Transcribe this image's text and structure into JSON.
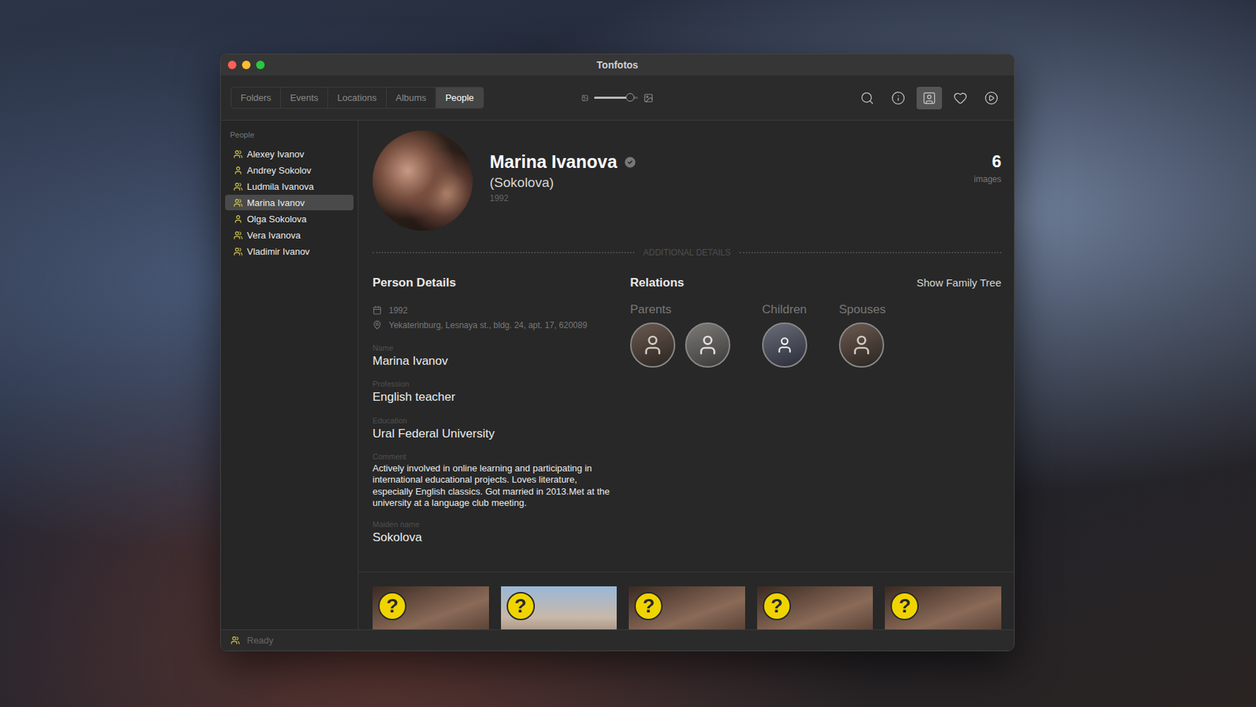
{
  "window": {
    "title": "Tonfotos"
  },
  "tabs": [
    {
      "label": "Folders",
      "selected": false
    },
    {
      "label": "Events",
      "selected": false
    },
    {
      "label": "Locations",
      "selected": false
    },
    {
      "label": "Albums",
      "selected": false
    },
    {
      "label": "People",
      "selected": true
    }
  ],
  "zoom": {
    "level": 0.82
  },
  "toolbar_buttons": [
    {
      "selected": false
    },
    {
      "selected": false
    },
    {
      "selected": true
    },
    {
      "selected": false
    },
    {
      "selected": false
    }
  ],
  "sidebar": {
    "header": "People",
    "items": [
      {
        "label": "Alexey Ivanov",
        "kind": "family",
        "selected": false
      },
      {
        "label": "Andrey Sokolov",
        "kind": "single",
        "selected": false
      },
      {
        "label": "Ludmila Ivanova",
        "kind": "family",
        "selected": false
      },
      {
        "label": "Marina Ivanov",
        "kind": "family",
        "selected": true
      },
      {
        "label": "Olga Sokolova",
        "kind": "single",
        "selected": false
      },
      {
        "label": "Vera Ivanova",
        "kind": "family",
        "selected": false
      },
      {
        "label": "Vladimir Ivanov",
        "kind": "family",
        "selected": false
      }
    ]
  },
  "person": {
    "name": "Marina Ivanova",
    "verified": true,
    "maiden": "(Sokolova)",
    "year": "1992",
    "image_count": "6",
    "image_label": "images"
  },
  "section_label": "ADDITIONAL DETAILS",
  "details": {
    "title": "Person Details",
    "birth": "1992",
    "address": "Yekaterinburg, Lesnaya st., bldg. 24, apt. 17, 620089",
    "fields": [
      {
        "label": "Name",
        "value": "Marina Ivanov",
        "kind": "large"
      },
      {
        "label": "Profession",
        "value": "English teacher",
        "kind": "large"
      },
      {
        "label": "Education",
        "value": "Ural Federal University",
        "kind": "large"
      },
      {
        "label": "Comment",
        "value": "Actively involved in online learning and participating in international educational projects. Loves literature, especially English classics. Got married in 2013.Met at the university at a language club meeting.",
        "kind": "small"
      },
      {
        "label": "Maiden name",
        "value": "Sokolova",
        "kind": "large"
      }
    ]
  },
  "relations": {
    "title": "Relations",
    "link": "Show Family Tree",
    "groups": [
      {
        "label": "Parents",
        "members": [
          {
            "kind": "man"
          },
          {
            "kind": "woman"
          }
        ]
      },
      {
        "label": "Children",
        "members": [
          {
            "kind": "child"
          }
        ]
      },
      {
        "label": "Spouses",
        "members": [
          {
            "kind": "man"
          }
        ]
      }
    ]
  },
  "photos": [
    {
      "badge": "?"
    },
    {
      "badge": "?"
    },
    {
      "badge": "?"
    },
    {
      "badge": "?"
    },
    {
      "badge": "?"
    }
  ],
  "status_bar": {
    "text": "Ready"
  }
}
